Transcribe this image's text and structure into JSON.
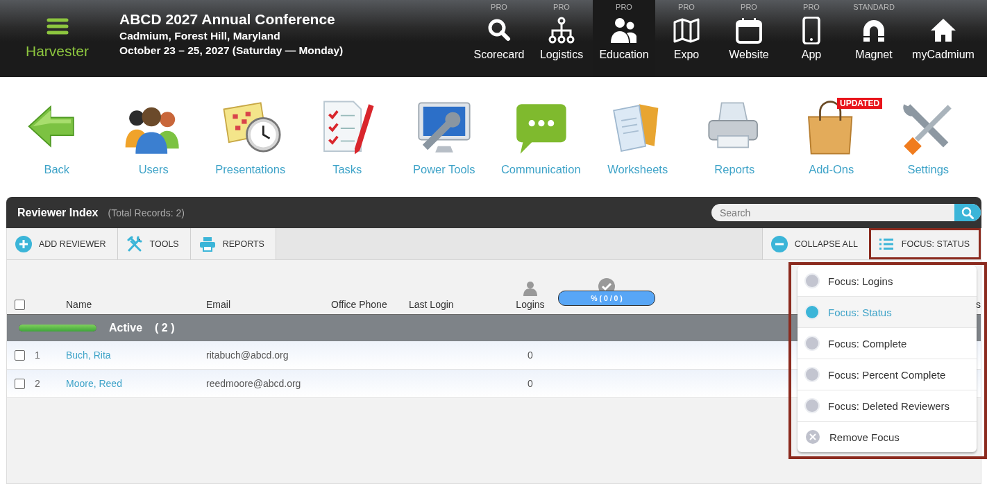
{
  "header": {
    "app_name": "Harvester",
    "title": "ABCD 2027 Annual Conference",
    "location": "Cadmium, Forest Hill, Maryland",
    "dates": "October 23 – 25, 2027 (Saturday — Monday)"
  },
  "nav": [
    {
      "tier": "PRO",
      "label": "Scorecard",
      "selected": false
    },
    {
      "tier": "PRO",
      "label": "Logistics",
      "selected": false
    },
    {
      "tier": "PRO",
      "label": "Education",
      "selected": true
    },
    {
      "tier": "PRO",
      "label": "Expo",
      "selected": false
    },
    {
      "tier": "PRO",
      "label": "Website",
      "selected": false
    },
    {
      "tier": "PRO",
      "label": "App",
      "selected": false
    },
    {
      "tier": "STANDARD",
      "label": "Magnet",
      "selected": false
    },
    {
      "label": "myCadmium",
      "selected": false
    }
  ],
  "launcher": [
    {
      "label": "Back"
    },
    {
      "label": "Users"
    },
    {
      "label": "Presentations"
    },
    {
      "label": "Tasks"
    },
    {
      "label": "Power Tools"
    },
    {
      "label": "Communication"
    },
    {
      "label": "Worksheets"
    },
    {
      "label": "Reports"
    },
    {
      "label": "Add-Ons",
      "badge": "UPDATED"
    },
    {
      "label": "Settings"
    }
  ],
  "panel": {
    "title": "Reviewer Index",
    "total": "(Total Records: 2)",
    "search": {
      "placeholder": "Search"
    },
    "actions": [
      {
        "label": "ADD REVIEWER"
      },
      {
        "label": "TOOLS"
      },
      {
        "label": "REPORTS"
      }
    ],
    "right_actions": [
      {
        "label": "COLLAPSE ALL",
        "highlighted": false
      },
      {
        "label": "FOCUS: STATUS",
        "highlighted": true
      }
    ],
    "select_all": {
      "checked": false
    },
    "columns": [
      "Name",
      "Email",
      "Office Phone",
      "Last Login",
      "Logins"
    ],
    "progress_label": "% ( 0 / 0 )",
    "column_8": "s",
    "group": {
      "label": "Active",
      "count": "( 2 )",
      "level": 1
    },
    "rows": [
      {
        "selected": false,
        "number": "1",
        "name": "Buch, Rita",
        "email": "ritabuch@abcd.org",
        "logins": "0"
      },
      {
        "selected": false,
        "number": "2",
        "name": "Moore, Reed",
        "email": "reedmoore@abcd.org",
        "logins": "0"
      }
    ]
  },
  "focus_menu": {
    "highlighted": true,
    "items": [
      {
        "kind": "option",
        "label": "Focus: Logins",
        "selected": false
      },
      {
        "kind": "option",
        "label": "Focus: Status",
        "selected": true
      },
      {
        "kind": "option",
        "label": "Focus: Complete",
        "selected": false
      },
      {
        "kind": "option",
        "label": "Focus: Percent Complete",
        "selected": false
      },
      {
        "kind": "option",
        "label": "Focus: Deleted Reviewers",
        "selected": false
      },
      {
        "kind": "remove",
        "label": "Remove Focus",
        "selected": false
      }
    ]
  }
}
